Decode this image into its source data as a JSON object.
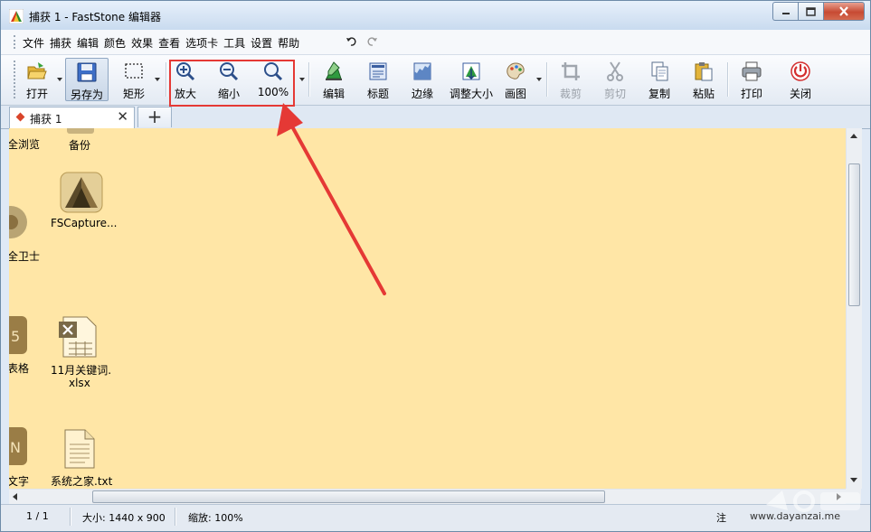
{
  "window": {
    "title": "捕获 1 - FastStone 编辑器"
  },
  "menu": {
    "items": [
      "文件",
      "捕获",
      "编辑",
      "颜色",
      "效果",
      "查看",
      "选项卡",
      "工具",
      "设置",
      "帮助"
    ],
    "undo_icon": "undo-icon",
    "redo_icon": "redo-icon"
  },
  "toolbar": {
    "open": "打开",
    "save_as": "另存为",
    "rect": "矩形",
    "zoom_in": "放大",
    "zoom_out": "缩小",
    "zoom_100": "100%",
    "edit": "编辑",
    "caption": "标题",
    "edge": "边缘",
    "resize": "调整大小",
    "draw": "画图",
    "crop": "裁剪",
    "cut": "剪切",
    "copy": "复制",
    "paste": "粘贴",
    "print": "打印",
    "close": "关闭"
  },
  "tabs": {
    "active_label": "捕获 1",
    "close_glyph": "✕",
    "add_glyph": "+"
  },
  "canvas": {
    "background_color": "#ffe6a6",
    "icons": [
      {
        "label": "全浏览"
      },
      {
        "label": "备份"
      },
      {
        "label": "FSCapture..."
      },
      {
        "label": "全卫士"
      },
      {
        "label": "表格"
      },
      {
        "label": "11月关键词."
      },
      {
        "label": "xlsx"
      },
      {
        "label": "文字"
      },
      {
        "label": "系统之家.txt"
      }
    ]
  },
  "status": {
    "page": "1 / 1",
    "size": "大小: 1440 x 900",
    "zoom": "缩放: 100%",
    "note": "注",
    "site": "www.dayanzai.me"
  },
  "annotation": {
    "highlight_color": "#e53935"
  }
}
